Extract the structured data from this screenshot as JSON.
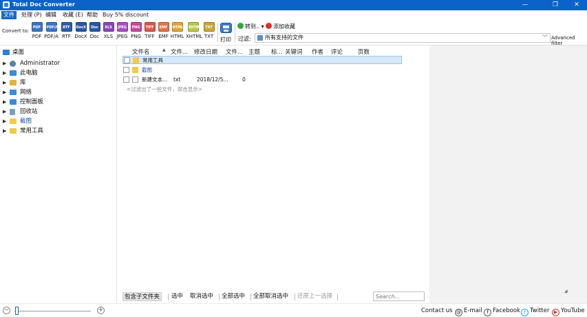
{
  "window": {
    "title": "Total Doc Converter",
    "controls": [
      "—",
      "❐",
      "✕"
    ]
  },
  "menu": [
    {
      "label": "文件",
      "active": true
    },
    {
      "label": "处理 (P)"
    },
    {
      "label": "编辑"
    },
    {
      "label": "收藏 (E)"
    },
    {
      "label": "帮助"
    },
    {
      "label": "Buy 5% discount"
    }
  ],
  "toolbar": {
    "convert_label": "Convert to:",
    "formats": [
      {
        "label": "PDF",
        "icon": "PDF",
        "color": "#3b74c6"
      },
      {
        "label": "PDF/A",
        "icon": "PDF/A",
        "color": "#3b74c6"
      },
      {
        "label": "RTF",
        "icon": "RTF",
        "color": "#2f5ea8"
      },
      {
        "label": "DocX",
        "icon": "DocX",
        "color": "#2a55a6"
      },
      {
        "label": "Doc",
        "icon": "Doc",
        "color": "#2a55a6"
      },
      {
        "label": "XLS",
        "icon": "XLS",
        "color": "#8a44b7"
      },
      {
        "label": "JPEG",
        "icon": "JPEG",
        "color": "#a84fc0"
      },
      {
        "label": "PNG",
        "icon": "PNG",
        "color": "#c64a9a"
      },
      {
        "label": "TIFF",
        "icon": "TIFF",
        "color": "#d9584a"
      },
      {
        "label": "EMF",
        "icon": "EMF",
        "color": "#e2734a"
      },
      {
        "label": "HTML",
        "icon": "HTML",
        "color": "#e0a43a"
      },
      {
        "label": "XHTML",
        "icon": "XHTML",
        "color": "#b8c84a"
      },
      {
        "label": "TXT",
        "icon": "TXT",
        "color": "#c9a63a"
      }
    ],
    "print_label": "打印",
    "goto_label": "转到..",
    "goto_arrow": "▾",
    "favorite_label": "添加收藏",
    "filter_label": "过滤:",
    "filter_value": "所有支持的文件",
    "filter_arrow": "﹀",
    "advanced_filter": "Advanced filter"
  },
  "tree": [
    {
      "label": "桌面",
      "expandable": false,
      "color": "#2f7fd6"
    },
    {
      "label": "Administrator",
      "expandable": true,
      "color": "#5b7ea6"
    },
    {
      "label": "此电脑",
      "expandable": true,
      "color": "#3a8bd9"
    },
    {
      "label": "库",
      "expandable": true,
      "color": "#e0b440"
    },
    {
      "label": "网络",
      "expandable": true,
      "color": "#3a8bd9"
    },
    {
      "label": "控制面板",
      "expandable": true,
      "color": "#3a8bd9"
    },
    {
      "label": "回收站",
      "expandable": true,
      "color": "#7aa0c8"
    },
    {
      "label": "截图",
      "expandable": true,
      "color": "#f2c94c"
    },
    {
      "label": "常用工具",
      "expandable": true,
      "color": "#f2c94c"
    }
  ],
  "columns": [
    "文件名",
    "文件...",
    "修改日期",
    "文件...",
    "主题",
    "标...",
    "关键词",
    "作者",
    "评论",
    "页数"
  ],
  "sort_arrow": "▲",
  "rows": [
    {
      "name": "常用工具",
      "type": "",
      "date": "",
      "size": "",
      "folder": true,
      "selected": true
    },
    {
      "name": "截图",
      "type": "",
      "date": "",
      "size": "",
      "folder": true,
      "selected": false
    },
    {
      "name": "新建文本...",
      "type": "txt",
      "date": "2018/12/5...",
      "size": "0",
      "folder": false,
      "selected": false
    }
  ],
  "hint": "<过滤出了一些文件，双击显示>",
  "bottom_buttons": [
    {
      "label": "包含子文件夹",
      "pressed": true
    },
    {
      "label": "选中"
    },
    {
      "label": "取消选中"
    },
    {
      "label": "全部选中"
    },
    {
      "label": "全部取消选中"
    },
    {
      "label": "还原上一选择",
      "disabled": true
    }
  ],
  "search_placeholder": "Search...",
  "status": {
    "zoom_minus": "−",
    "zoom_plus": "+",
    "contact": "Contact us",
    "email": "E-mail",
    "facebook": "Facebook",
    "twitter": "Twitter",
    "youtube": "YouTube"
  },
  "preview_marker": "◢"
}
